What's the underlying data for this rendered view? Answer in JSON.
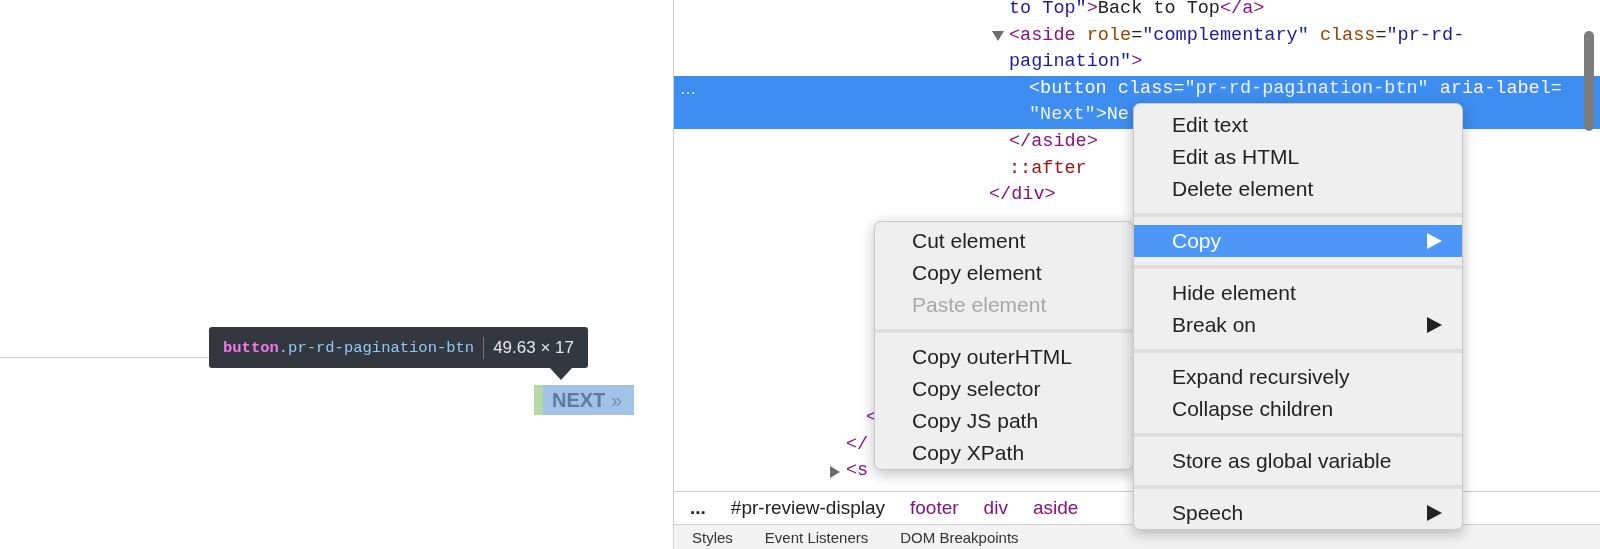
{
  "page": {
    "next_button": {
      "label": "NEXT",
      "icon": "»"
    }
  },
  "tooltip": {
    "tag": "button",
    "class_name": ".pr-rd-pagination-btn",
    "size": "49.63 × 17"
  },
  "dom_tree": {
    "top": [
      {
        "children": [
          {
            "selected": false,
            "lines": [
              [
                {
                  "kind": "value",
                  "text": "to Top\""
                },
                {
                  "kind": "tag",
                  "text": ">"
                },
                {
                  "kind": "text",
                  "text": "Back to Top"
                },
                {
                  "kind": "tag",
                  "text": "</a>"
                }
              ]
            ]
          },
          {
            "selected": false,
            "expanded": true,
            "lines": [
              [
                {
                  "kind": "tag",
                  "text": "<aside"
                },
                {
                  "kind": "attr",
                  "text": " role"
                },
                {
                  "kind": "text",
                  "text": "="
                },
                {
                  "kind": "value",
                  "text": "\"complementary\""
                },
                {
                  "kind": "attr",
                  "text": " class"
                },
                {
                  "kind": "text",
                  "text": "="
                },
                {
                  "kind": "value",
                  "text": "\"pr-rd-"
                }
              ],
              [
                {
                  "kind": "value",
                  "text": "pagination\""
                },
                {
                  "kind": "tag",
                  "text": ">"
                }
              ]
            ],
            "children": [
              {
                "selected": true,
                "dots": "…",
                "lines": [
                  [
                    {
                      "kind": "tag",
                      "text": "<button"
                    },
                    {
                      "kind": "attr",
                      "text": " class"
                    },
                    {
                      "kind": "text",
                      "text": "="
                    },
                    {
                      "kind": "value",
                      "text": "\"pr-rd-pagination-btn\""
                    },
                    {
                      "kind": "attr",
                      "text": " aria-label"
                    },
                    {
                      "kind": "text",
                      "text": "="
                    }
                  ],
                  [
                    {
                      "kind": "value",
                      "text": "\"Next\""
                    },
                    {
                      "kind": "tag",
                      "text": ">"
                    },
                    {
                      "kind": "text",
                      "text": "Ne"
                    }
                  ]
                ]
              }
            ],
            "close": [
              {
                "kind": "tag",
                "text": "</aside>"
              }
            ]
          },
          {
            "selected": false,
            "lines": [
              [
                {
                  "kind": "pseudo",
                  "text": "::after"
                }
              ]
            ]
          }
        ],
        "close": [
          {
            "kind": "tag",
            "text": "</div>"
          }
        ]
      }
    ],
    "bottom": [
      {
        "children": [
          {
            "close": [
              {
                "kind": "tag",
                "text": "<"
              }
            ]
          }
        ],
        "close": [
          {
            "kind": "tag",
            "text": "</"
          }
        ]
      },
      {
        "selected": false,
        "expanded": false,
        "lines": [
          [
            {
              "kind": "tag",
              "text": "<s"
            }
          ]
        ]
      }
    ]
  },
  "breadcrumbs": [
    {
      "kind": "more",
      "text": "..."
    },
    {
      "kind": "id",
      "text": "#pr-review-display"
    },
    {
      "kind": "tag",
      "text": "footer"
    },
    {
      "kind": "tag",
      "text": "div"
    },
    {
      "kind": "tag",
      "text": "aside"
    }
  ],
  "panel_tabs": [
    {
      "label": "Styles"
    },
    {
      "label": "Event Listeners"
    },
    {
      "label": "DOM Breakpoints"
    }
  ],
  "context_menu": [
    {
      "kind": "item",
      "label": "Edit text",
      "selected": false,
      "submenu": false
    },
    {
      "kind": "item",
      "label": "Edit as HTML",
      "selected": false,
      "submenu": false
    },
    {
      "kind": "item",
      "label": "Delete element",
      "selected": false,
      "submenu": false
    },
    {
      "kind": "separator"
    },
    {
      "kind": "item",
      "label": "Copy",
      "selected": true,
      "submenu": true
    },
    {
      "kind": "separator"
    },
    {
      "kind": "item",
      "label": "Hide element",
      "selected": false,
      "submenu": false
    },
    {
      "kind": "item",
      "label": "Break on",
      "selected": false,
      "submenu": true
    },
    {
      "kind": "separator"
    },
    {
      "kind": "item",
      "label": "Expand recursively",
      "selected": false,
      "submenu": false
    },
    {
      "kind": "item",
      "label": "Collapse children",
      "selected": false,
      "submenu": false
    },
    {
      "kind": "separator"
    },
    {
      "kind": "item",
      "label": "Store as global variable",
      "selected": false,
      "submenu": false
    },
    {
      "kind": "separator"
    },
    {
      "kind": "item",
      "label": "Speech",
      "selected": false,
      "submenu": true
    }
  ],
  "copy_submenu": [
    {
      "kind": "item",
      "label": "Cut element",
      "disabled": false
    },
    {
      "kind": "item",
      "label": "Copy element",
      "disabled": false
    },
    {
      "kind": "item",
      "label": "Paste element",
      "disabled": true
    },
    {
      "kind": "separator"
    },
    {
      "kind": "item",
      "label": "Copy outerHTML",
      "disabled": false
    },
    {
      "kind": "item",
      "label": "Copy selector",
      "disabled": false
    },
    {
      "kind": "item",
      "label": "Copy JS path",
      "disabled": false
    },
    {
      "kind": "item",
      "label": "Copy XPath",
      "disabled": false
    }
  ]
}
